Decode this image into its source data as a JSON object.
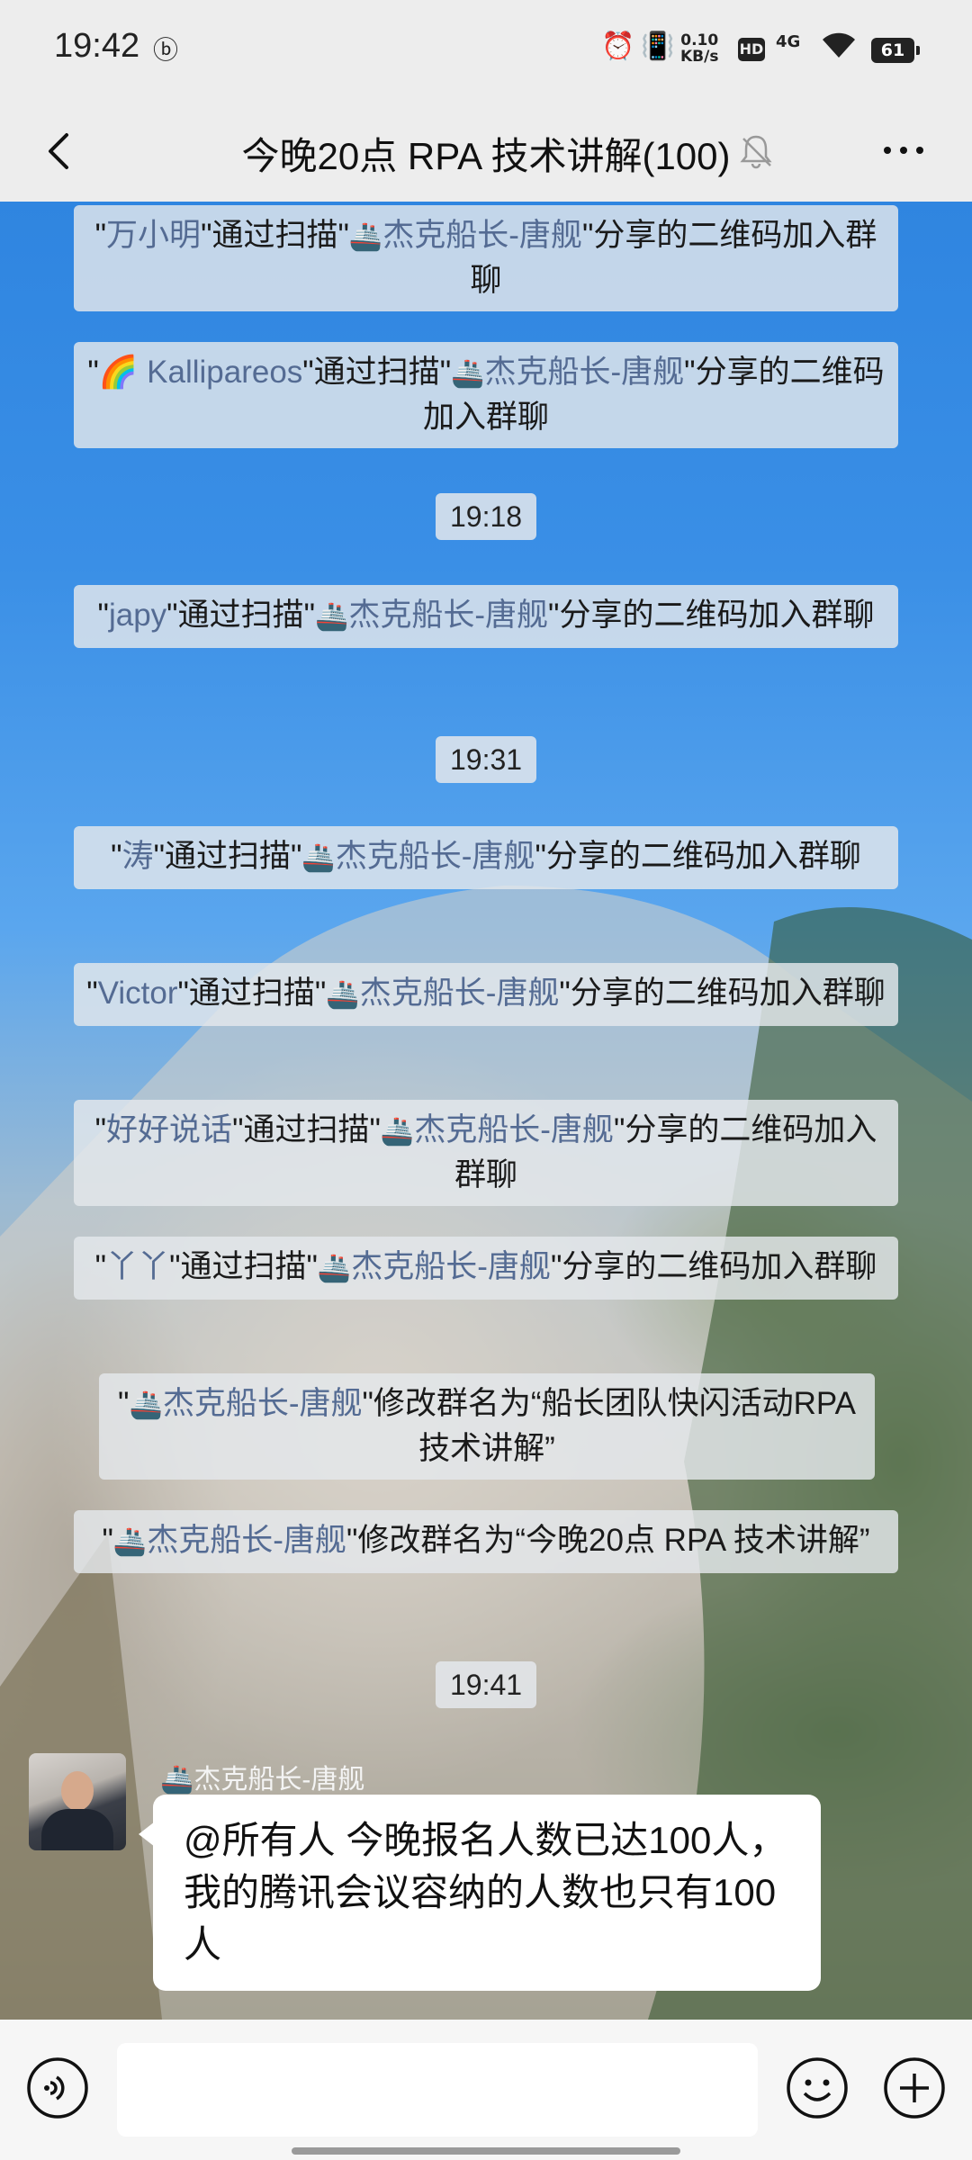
{
  "status_bar": {
    "time": "19:42",
    "net_speed_top": "0.10",
    "net_speed_bottom": "KB/s",
    "hd": "HD",
    "network": "4G",
    "battery": "61"
  },
  "header": {
    "title": "今晚20点 RPA 技术讲解(100)"
  },
  "ship_emoji": "🚢",
  "messages": [
    {
      "before": "\"",
      "name": "万小明",
      "mid": "\"通过扫描\"",
      "sharer": "杰克船长-唐舰",
      "after": "\"分享的二维码加入群聊"
    },
    {
      "before": "\"",
      "name": "🌈 Kallipareos",
      "mid": "\"通过扫描\"",
      "sharer": "杰克船长-唐舰",
      "after": "\"分享的二维码加入群聊"
    },
    {
      "before": "\"",
      "name": "japy",
      "mid": "\"通过扫描\"",
      "sharer": "杰克船长-唐舰",
      "after": "\"分享的二维码加入群聊"
    },
    {
      "before": "\"",
      "name": "涛",
      "mid": "\"通过扫描\"",
      "sharer": "杰克船长-唐舰",
      "after": "\"分享的二维码加入群聊"
    },
    {
      "before": "\"",
      "name": "Victor",
      "mid": "\"通过扫描\"",
      "sharer": "杰克船长-唐舰",
      "after": "\"分享的二维码加入群聊"
    },
    {
      "before": "\"",
      "name": "好好说话",
      "mid": "\"通过扫描\"",
      "sharer": "杰克船长-唐舰",
      "after": "\"分享的二维码加入群聊"
    },
    {
      "before": "\"",
      "name": "丫丫",
      "mid": "\"通过扫描\"",
      "sharer": "杰克船长-唐舰",
      "after": "\"分享的二维码加入群聊"
    },
    {
      "before": "\"",
      "sharer": "杰克船长-唐舰",
      "after": "\"修改群名为“船长团队快闪活动RPA 技术讲解”"
    },
    {
      "before": "\"",
      "sharer": "杰克船长-唐舰",
      "after": "\"修改群名为“今晚20点 RPA 技术讲解”"
    }
  ],
  "timestamps": [
    "19:18",
    "19:31",
    "19:41"
  ],
  "chat_message": {
    "sender": "杰克船长-唐舰",
    "text": "@所有人  今晚报名人数已达100人，我的腾讯会议容纳的人数也只有100人"
  }
}
